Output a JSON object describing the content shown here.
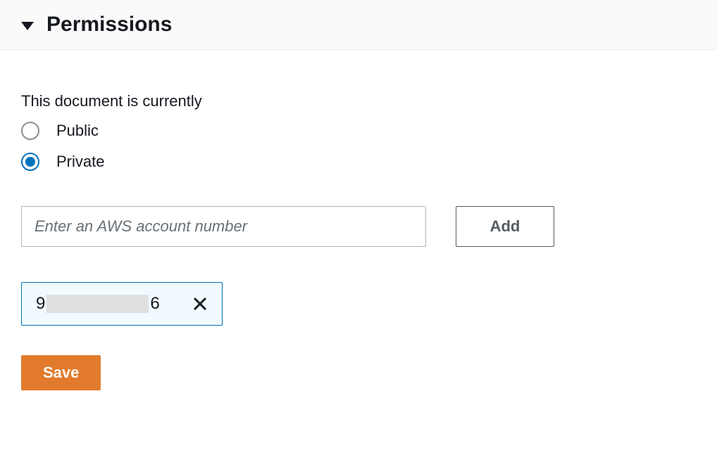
{
  "header": {
    "title": "Permissions"
  },
  "form": {
    "label": "This document is currently",
    "radio_public": "Public",
    "radio_private": "Private",
    "account_input_placeholder": "Enter an AWS account number",
    "account_input_value": "",
    "add_button": "Add",
    "chip_prefix": "9",
    "chip_suffix": "6",
    "save_button": "Save"
  }
}
